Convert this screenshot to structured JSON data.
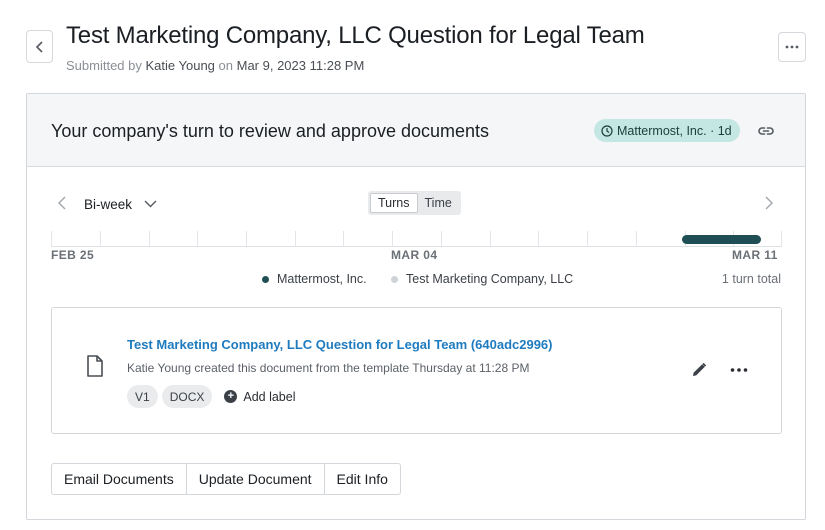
{
  "header": {
    "title": "Test Marketing Company, LLC Question for Legal Team",
    "submitted_prefix": "Submitted by",
    "submitter": "Katie Young",
    "on_word": "on",
    "submitted_date": "Mar 9, 2023 11:28 PM"
  },
  "status": {
    "heading": "Your company's turn to review and approve documents",
    "party_badge": "Mattermost, Inc. · 1d",
    "badge_color": "#c5e7e3"
  },
  "timeline": {
    "period": "Bi-week",
    "view_options": [
      "Turns",
      "Time"
    ],
    "active_view": "Turns",
    "date_labels": [
      "FEB 25",
      "MAR 04",
      "MAR 11"
    ],
    "legend": [
      {
        "name": "Mattermost, Inc.",
        "color": "#1f4f54"
      },
      {
        "name": "Test Marketing Company, LLC",
        "color": "#cfd2d6"
      }
    ],
    "total": "1 turn total",
    "turns_color": "#1f4f54"
  },
  "document": {
    "title": "Test Marketing Company, LLC Question for Legal Team (640adc2996)",
    "description": "Katie Young created this document from the template Thursday at 11:28 PM",
    "tags": [
      "V1",
      "DOCX"
    ],
    "add_label": "Add label",
    "link_color": "#1f7bbf"
  },
  "actions": {
    "email": "Email Documents",
    "update": "Update Document",
    "edit_info": "Edit Info"
  },
  "icons": [
    "chevron-left-icon",
    "more-horizontal-icon",
    "clock-icon",
    "link-icon",
    "chevron-down-icon",
    "chevron-right-icon",
    "file-icon",
    "pencil-icon",
    "plus-circle-icon"
  ]
}
